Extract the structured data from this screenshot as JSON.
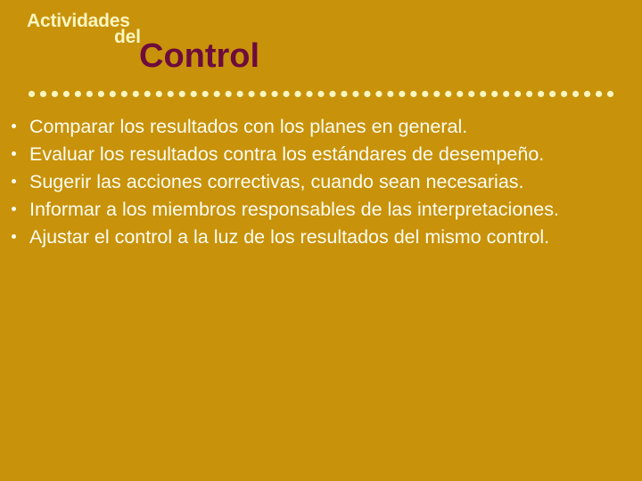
{
  "slide": {
    "background_color": "#c8920a",
    "title": {
      "line1": "Actividades",
      "line2": "del",
      "line3": "Control",
      "accent_color_small": "#fbf6c0",
      "accent_color_main": "#6d0c3c"
    },
    "divider": {
      "name": "dotted-divider",
      "dot_color": "#fbf6c0",
      "dot_count": 51
    },
    "bullets": [
      {
        "text": "Comparar los resultados con los planes en general."
      },
      {
        "text": "Evaluar los resultados contra los estándares de desempeño."
      },
      {
        "text": "Sugerir las acciones correctivas, cuando sean necesarias."
      },
      {
        "text": "Informar a los miembros responsables de las interpretaciones."
      },
      {
        "text": "Ajustar el control a la luz de los resultados del mismo control."
      }
    ],
    "body_text_color": "#fdfdf2"
  }
}
